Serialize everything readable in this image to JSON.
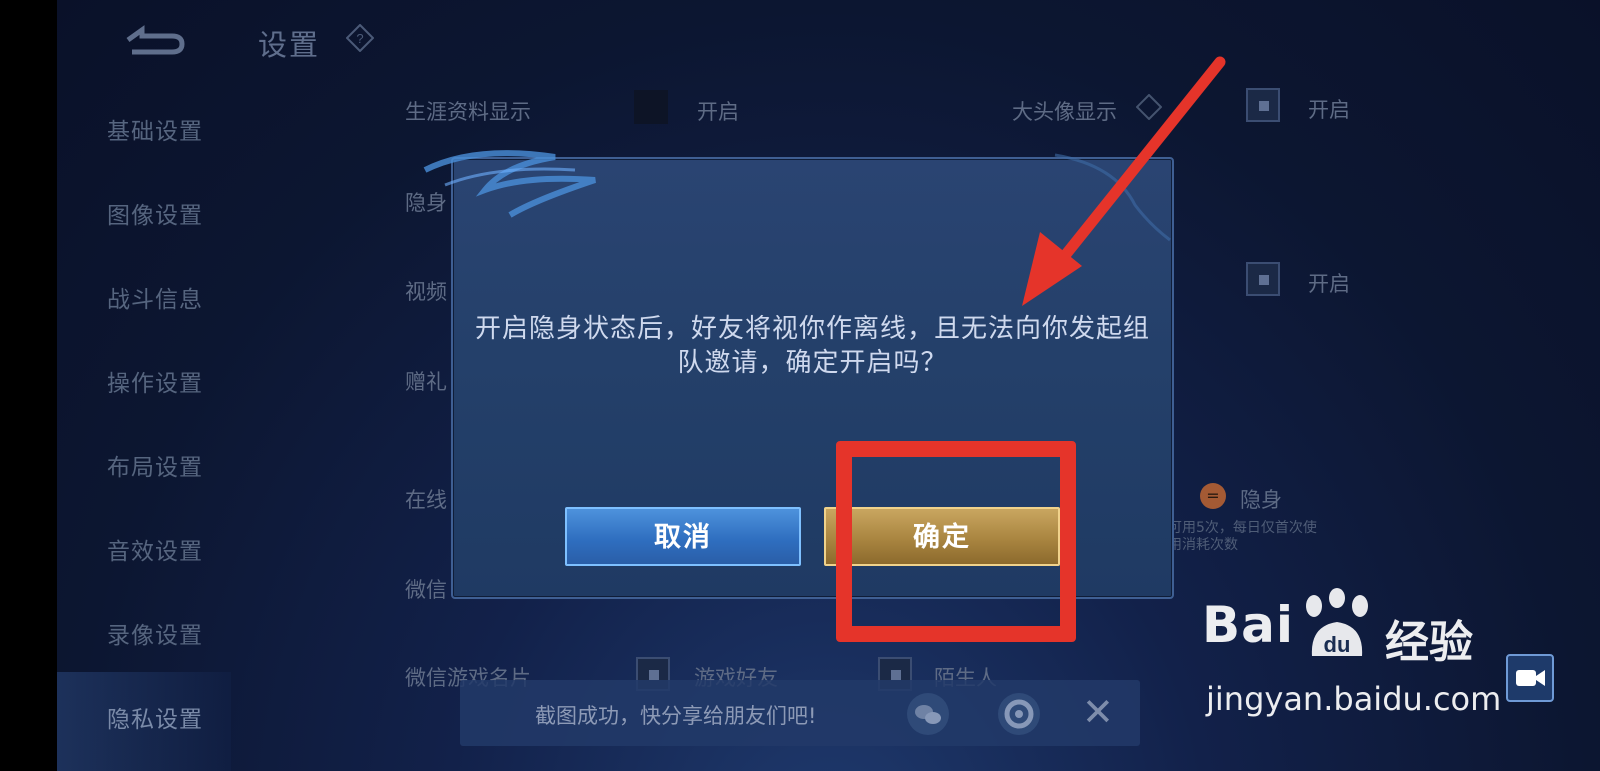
{
  "header": {
    "title": "设置"
  },
  "sidebar": {
    "items": [
      {
        "label": "基础设置"
      },
      {
        "label": "图像设置"
      },
      {
        "label": "战斗信息"
      },
      {
        "label": "操作设置"
      },
      {
        "label": "布局设置"
      },
      {
        "label": "音效设置"
      },
      {
        "label": "录像设置"
      },
      {
        "label": "隐私设置"
      }
    ]
  },
  "settings": {
    "career_label": "生涯资料显示",
    "career_option": "开启",
    "bighead_label": "大头像显示",
    "bighead_option": "开启",
    "invisible_label_partial": "隐身",
    "video_label_partial": "视频",
    "video_option": "开启",
    "gift_label_partial": "赠礼",
    "online_label_partial": "在线",
    "online_hide_option": "隐身",
    "online_note": "可用5次，每日仅首次使\n用消耗次数",
    "wechat_label_partial": "微信",
    "wechat_card_label": "微信游戏名片",
    "wechat_card_opt1": "游戏好友",
    "wechat_card_opt2": "陌生人"
  },
  "dialog": {
    "message": "开启隐身状态后，好友将视你作离线，且无法向你发起组队邀请，确定开启吗？",
    "cancel_label": "取消",
    "confirm_label": "确定"
  },
  "toast": {
    "text": "截图成功，快分享给朋友们吧!"
  },
  "watermark": {
    "logo_text": "Bai",
    "logo_du": "du",
    "cn_text": "经验",
    "url": "jingyan.baidu.com"
  },
  "colors": {
    "annotation_red": "#e5342a",
    "confirm_gold": "#a98540",
    "cancel_blue": "#2f6fc0"
  }
}
